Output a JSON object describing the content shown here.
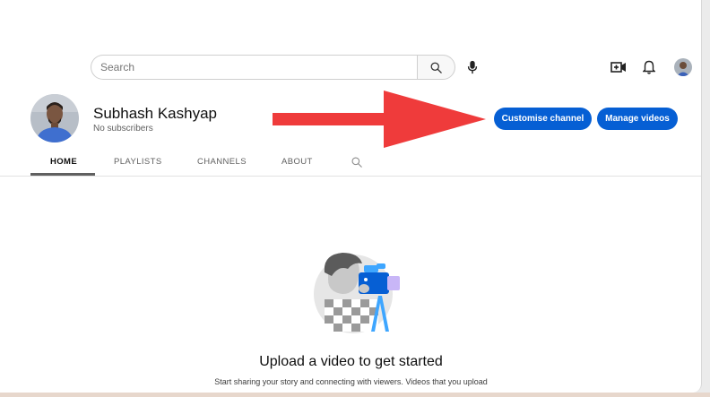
{
  "header": {
    "search_placeholder": "Search"
  },
  "channel": {
    "name": "Subhash Kashyap",
    "subscribers": "No subscribers"
  },
  "buttons": {
    "customise": "Customise channel",
    "manage": "Manage videos"
  },
  "tabs": [
    {
      "label": "HOME",
      "active": true
    },
    {
      "label": "PLAYLISTS",
      "active": false
    },
    {
      "label": "CHANNELS",
      "active": false
    },
    {
      "label": "ABOUT",
      "active": false
    }
  ],
  "empty_state": {
    "title": "Upload a video to get started",
    "description": "Start sharing your story and connecting with viewers. Videos that you upload"
  },
  "icons": [
    "search-icon",
    "microphone-icon",
    "create-video-icon",
    "bell-icon",
    "tab-search-icon",
    "camera-person-illustration"
  ],
  "colors": {
    "accent": "#065fd4",
    "arrow": "#ef3b3b"
  }
}
